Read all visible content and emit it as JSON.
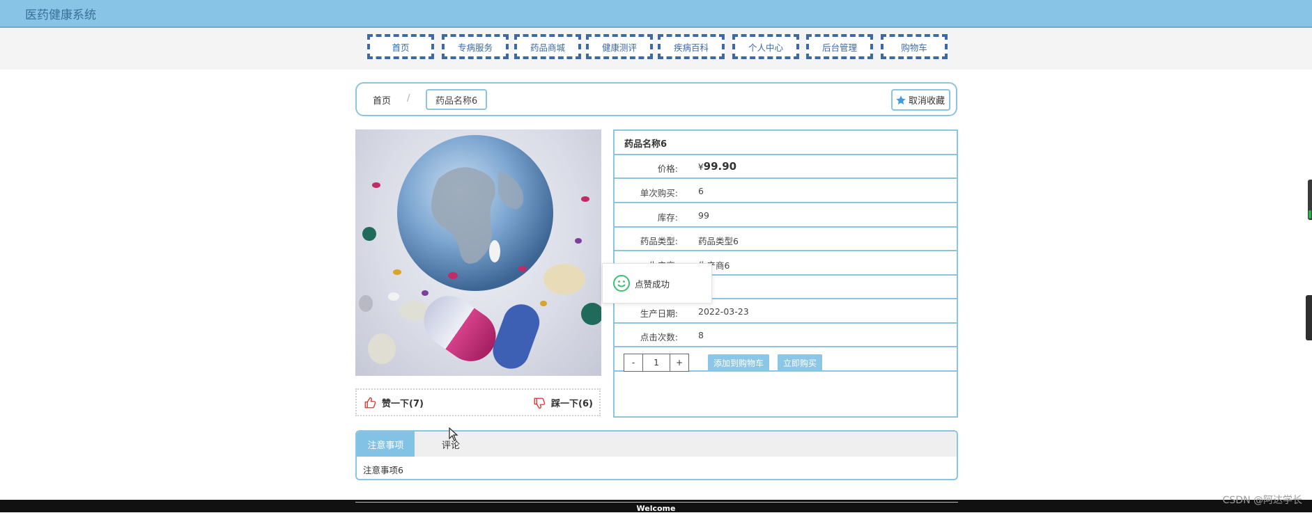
{
  "app": {
    "title": "医药健康系统"
  },
  "nav": {
    "items": [
      {
        "label": "首页"
      },
      {
        "label": "专病服务"
      },
      {
        "label": "药品商城"
      },
      {
        "label": "健康测评"
      },
      {
        "label": "疾病百科"
      },
      {
        "label": "个人中心"
      },
      {
        "label": "后台管理"
      },
      {
        "label": "购物车"
      }
    ]
  },
  "breadcrumb": {
    "home": "首页",
    "separator": "/",
    "current": "药品名称6",
    "favorite_label": "取消收藏"
  },
  "product": {
    "name": "药品名称6",
    "price_label": "价格:",
    "price_currency": "¥",
    "price": "99.90",
    "rows": [
      {
        "label": "单次购买:",
        "value": "6"
      },
      {
        "label": "库存:",
        "value": "99"
      },
      {
        "label": "药品类型:",
        "value": "药品类型6"
      },
      {
        "label": "生产商:",
        "value": "生产商6"
      },
      {
        "label": "",
        "value": "格6"
      },
      {
        "label": "生产日期:",
        "value": "2022-03-23"
      },
      {
        "label": "点击次数:",
        "value": "8"
      }
    ],
    "quantity": {
      "minus": "-",
      "value": "1",
      "plus": "+"
    },
    "add_to_cart_label": "添加到购物车",
    "buy_now_label": "立即购买"
  },
  "votes": {
    "like_label": "赞一下(7)",
    "dislike_label": "踩一下(6)"
  },
  "toast": {
    "message": "点赞成功"
  },
  "tabs": {
    "items": [
      {
        "label": "注意事项",
        "active": true
      },
      {
        "label": "评论",
        "active": false
      }
    ],
    "content": "注意事项6"
  },
  "footer": {
    "text": "Welcome"
  },
  "watermark": "CSDN @阿达学长",
  "colors": {
    "topbar": "#87c4e6",
    "nav_border": "#3d6aa6",
    "accent": "#8cc3df",
    "button": "#8cc6e7"
  }
}
